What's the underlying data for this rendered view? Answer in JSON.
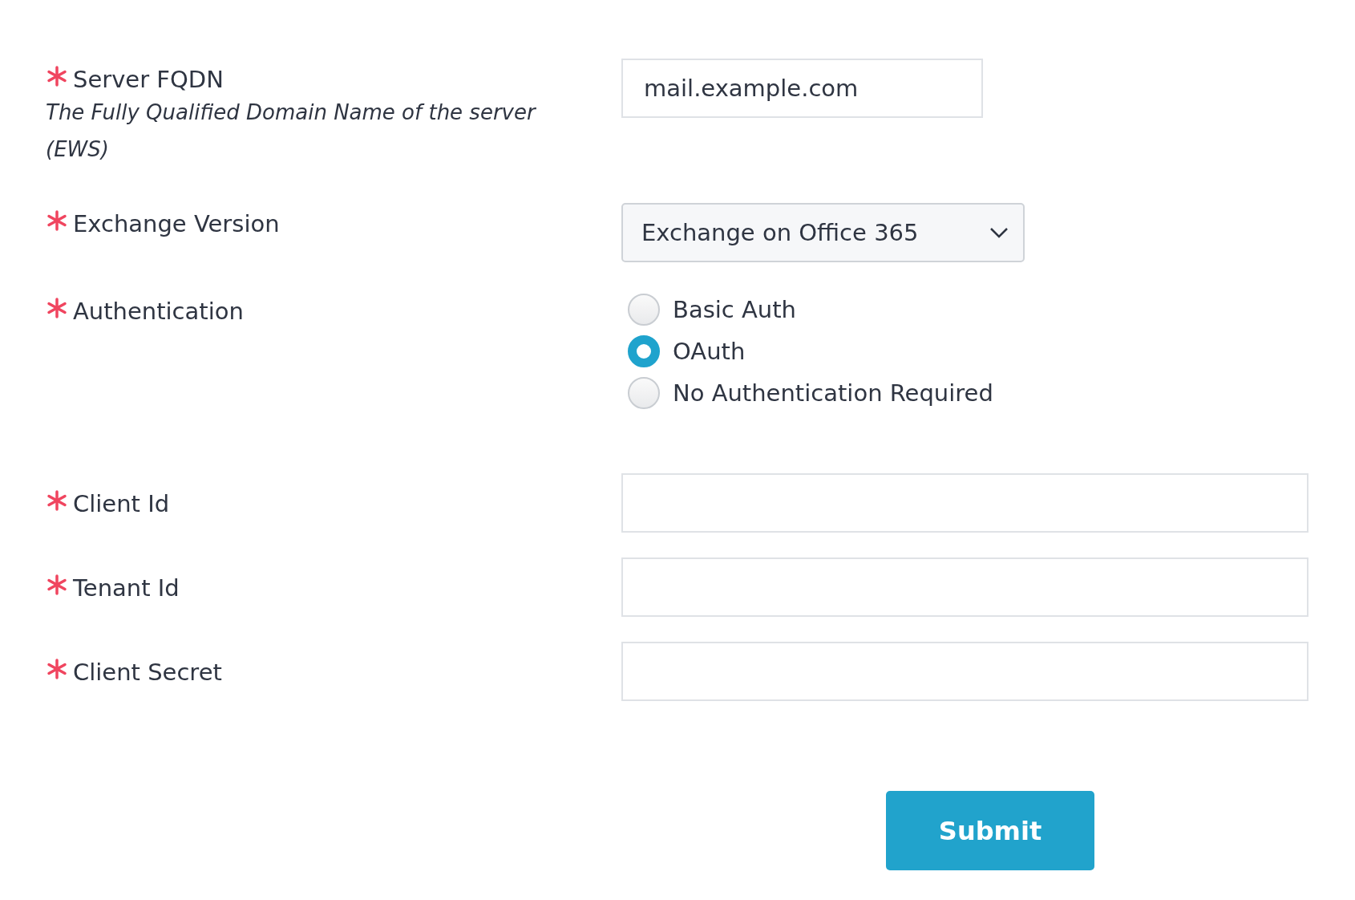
{
  "fields": [
    {
      "kind": "text",
      "label": "Server FQDN",
      "required": true,
      "description": "The Fully Qualified Domain Name of the server (EWS)",
      "value": "mail.example.com"
    },
    {
      "kind": "select",
      "label": "Exchange Version",
      "required": true,
      "value": "Exchange on Office 365"
    },
    {
      "kind": "radio",
      "label": "Authentication",
      "required": true,
      "options": [
        {
          "label": "Basic Auth",
          "selected": false
        },
        {
          "label": "OAuth",
          "selected": true
        },
        {
          "label": "No Authentication Required",
          "selected": false
        }
      ]
    },
    {
      "kind": "wide_text",
      "label": "Client Id",
      "required": true
    },
    {
      "kind": "wide_text",
      "label": "Tenant Id",
      "required": true
    },
    {
      "kind": "wide_text",
      "label": "Client Secret",
      "required": true
    }
  ],
  "submit": {
    "label": "Submit"
  }
}
